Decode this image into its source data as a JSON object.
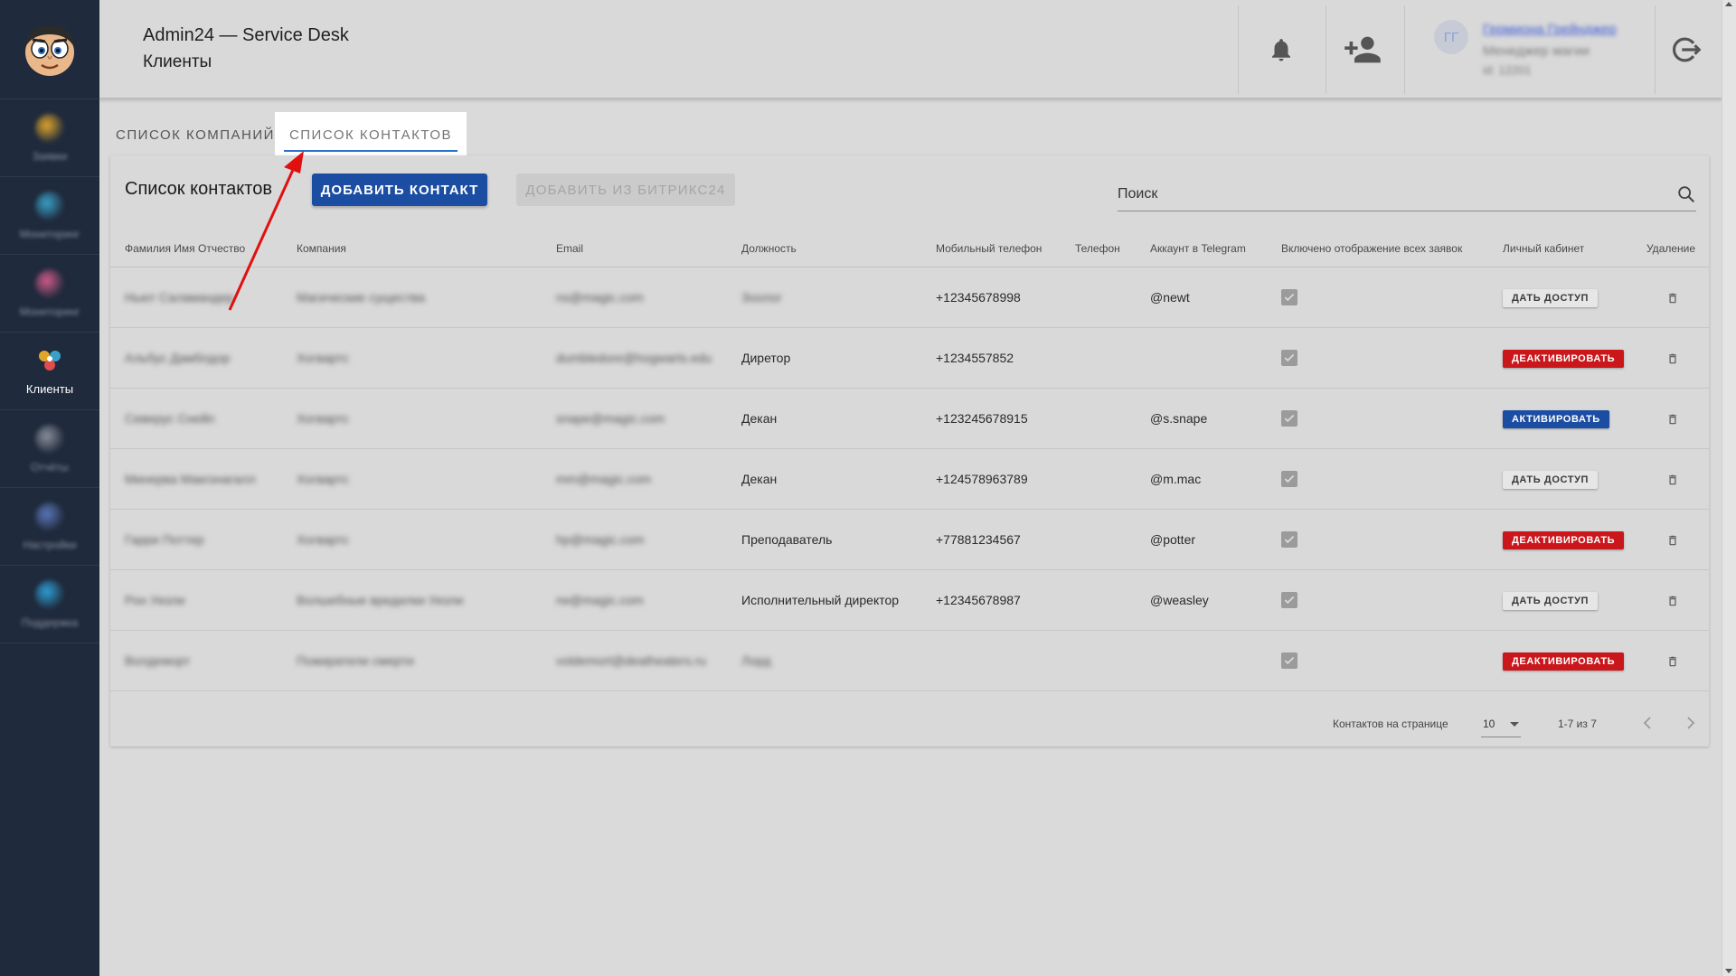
{
  "sidebar": {
    "items": [
      {
        "label": "Заявки",
        "color": "#e0a62a"
      },
      {
        "label": "Мониторинг",
        "color": "#3aa0c8"
      },
      {
        "label": "Мониторинг",
        "color": "#d05a8a"
      },
      {
        "label": "Клиенты",
        "color": "#e04d4d",
        "active": true
      },
      {
        "label": "Отчёты",
        "color": "#8a8f99"
      },
      {
        "label": "Настройки",
        "color": "#5a76b8"
      },
      {
        "label": "Поддержка",
        "color": "#2f9fd6"
      }
    ]
  },
  "header": {
    "app_title": "Admin24 — Service Desk",
    "page_title": "Клиенты",
    "user_initials": "ГГ",
    "user_name": "Гермиона Грейнджер",
    "user_role": "Менеджер магии",
    "user_id": "id: 12201"
  },
  "tabs": [
    {
      "label": "СПИСОК КОМПАНИЙ"
    },
    {
      "label": "СПИСОК КОНТАКТОВ"
    }
  ],
  "card": {
    "title": "Список контактов",
    "add_button": "ДОБАВИТЬ КОНТАКТ",
    "bitrix_button": "ДОБАВИТЬ ИЗ БИТРИКС24",
    "search_placeholder": "Поиск"
  },
  "table": {
    "columns": [
      "Фамилия Имя Отчество",
      "Компания",
      "Email",
      "Должность",
      "Мобильный телефон",
      "Телефон",
      "Аккаунт в Telegram",
      "Включено отображение всех заявок",
      "Личный кабинет",
      "Удаление"
    ],
    "rows": [
      {
        "name": "Ньют Саламандер",
        "company": "Магические существа",
        "email": "ns@magic.com",
        "position": "Зоолог",
        "position_blur": true,
        "mobile": "+12345678998",
        "phone": "",
        "telegram": "@newt",
        "action": "ДАТЬ ДОСТУП",
        "action_type": "grant"
      },
      {
        "name": "Альбус Дамблдор",
        "company": "Хогвартс",
        "email": "dumbledore@hogwarts.edu",
        "position": "Диретор",
        "position_blur": false,
        "mobile": "+1234557852",
        "phone": "",
        "telegram": "",
        "action": "ДЕАКТИВИРОВАТЬ",
        "action_type": "deact"
      },
      {
        "name": "Северус Снейп",
        "company": "Хогвартс",
        "email": "snape@magic.com",
        "position": "Декан",
        "position_blur": false,
        "mobile": "+123245678915",
        "phone": "",
        "telegram": "@s.snape",
        "action": "АКТИВИРОВАТЬ",
        "action_type": "act"
      },
      {
        "name": "Минерва Макгонагалл",
        "company": "Хогвартс",
        "email": "mm@magic.com",
        "position": "Декан",
        "position_blur": false,
        "mobile": "+124578963789",
        "phone": "",
        "telegram": "@m.mac",
        "action": "ДАТЬ ДОСТУП",
        "action_type": "grant"
      },
      {
        "name": "Гарри Поттер",
        "company": "Хогвартс",
        "email": "hp@magic.com",
        "position": "Преподаватель",
        "position_blur": false,
        "mobile": "+77881234567",
        "phone": "",
        "telegram": "@potter",
        "action": "ДЕАКТИВИРОВАТЬ",
        "action_type": "deact"
      },
      {
        "name": "Рон Уизли",
        "company": "Волшебные вредилки Уизли",
        "email": "rw@magic.com",
        "position": "Исполнительный директор",
        "position_blur": false,
        "mobile": "+12345678987",
        "phone": "",
        "telegram": "@weasley",
        "action": "ДАТЬ ДОСТУП",
        "action_type": "grant"
      },
      {
        "name": "Волдеморт",
        "company": "Пожиратели смерти",
        "email": "voldemort@deatheaters.ru",
        "position": "Лорд",
        "position_blur": true,
        "mobile": "",
        "phone": "",
        "telegram": "",
        "action": "ДЕАКТИВИРОВАТЬ",
        "action_type": "deact"
      }
    ]
  },
  "pagination": {
    "rows_per_page_label": "Контактов на странице",
    "rows_per_page": "10",
    "range": "1-7 из 7"
  },
  "colors": {
    "accent": "#1b4da2",
    "danger": "#c9171c",
    "sidebar": "#1f2a3c",
    "annotation": "#e01010"
  },
  "icons": [
    "bell-icon",
    "add-user-icon",
    "logout-icon",
    "search-icon",
    "trash-icon",
    "chevron-left-icon",
    "chevron-right-icon"
  ]
}
